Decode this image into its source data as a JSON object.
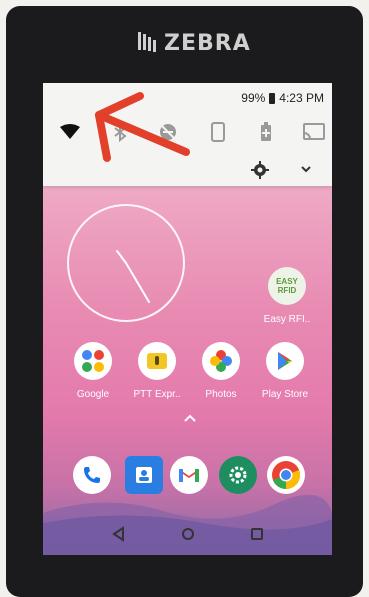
{
  "brand": "ZEBRA",
  "status": {
    "battery": "99%",
    "time": "4:23 PM"
  },
  "quick_settings": [
    "wifi-icon",
    "bluetooth-icon",
    "dnd-icon",
    "rotate-icon",
    "battery-saver-icon",
    "cast-icon"
  ],
  "home": {
    "widget_app": {
      "label": "Easy RFI..",
      "icon_text": "EASY RFID"
    },
    "apps": [
      {
        "label": "Google",
        "icon": "google-folder-icon"
      },
      {
        "label": "PTT Expr..",
        "icon": "ptt-express-icon"
      },
      {
        "label": "Photos",
        "icon": "photos-icon"
      },
      {
        "label": "Play Store",
        "icon": "play-store-icon"
      }
    ],
    "dock": [
      "phone-icon",
      "contacts-icon",
      "gmail-icon",
      "settings-icon",
      "chrome-icon"
    ]
  },
  "navbar": [
    "back-icon",
    "home-icon",
    "recents-icon"
  ],
  "colors": {
    "arrow": "#e2402a",
    "screen_top": "#f5d8e1",
    "screen_bottom": "#8a6aa5"
  }
}
